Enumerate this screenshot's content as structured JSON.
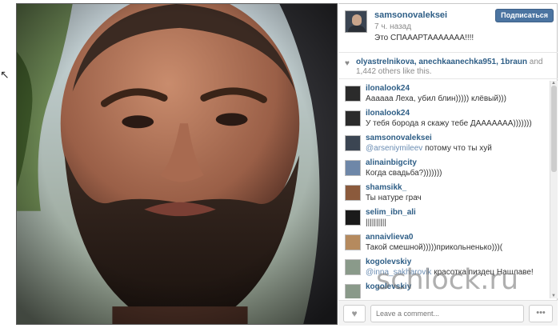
{
  "post": {
    "username": "samsonovaleksei",
    "time": "7 ч. назад",
    "caption": "Это СПАААРТААААААА!!!!",
    "follow_label": "Подписаться"
  },
  "likes": {
    "users": "olyastrelnikova, anechkaanechka951, 1braun",
    "rest": " and 1,442 others like this."
  },
  "comments": [
    {
      "user": "ilonalook24",
      "text": "Аааааа Леха, убил блин))))) клёвый)))",
      "avatar_color": "#2b2b2b"
    },
    {
      "user": "ilonalook24",
      "text": "У тебя борода я скажу тебе ДААААААА)))))))",
      "avatar_color": "#2b2b2b"
    },
    {
      "user": "samsonovaleksei",
      "mention": "@arseniymileev",
      "text": " потому что ты хуй",
      "avatar_color": "#3b4552"
    },
    {
      "user": "alinainbigcity",
      "text": "Когда свадьба?)))))))",
      "avatar_color": "#6e87a8"
    },
    {
      "user": "shamsikk_",
      "text": "Ты натуре грач",
      "avatar_color": "#8b5a3c"
    },
    {
      "user": "selim_ibn_ali",
      "text": "||||||||||",
      "avatar_color": "#1a1a1a"
    },
    {
      "user": "annaivlieva0",
      "text": "Такой смешной)))))прикольненько)))(",
      "avatar_color": "#b58a5e"
    },
    {
      "user": "kogolevskiy",
      "mention": "@inna_sakharovik",
      "text": " красотка пиздец Нашлаве!",
      "avatar_color": "#8a9a8a"
    },
    {
      "user": "kogolevskiy",
      "text": "",
      "avatar_color": "#8a9a8a"
    }
  ],
  "footer": {
    "comment_placeholder": "Leave a comment...",
    "more_label": "•••"
  },
  "watermark": "schlock.ru",
  "icons": {
    "heart": "heart-icon",
    "more": "more-icon"
  }
}
